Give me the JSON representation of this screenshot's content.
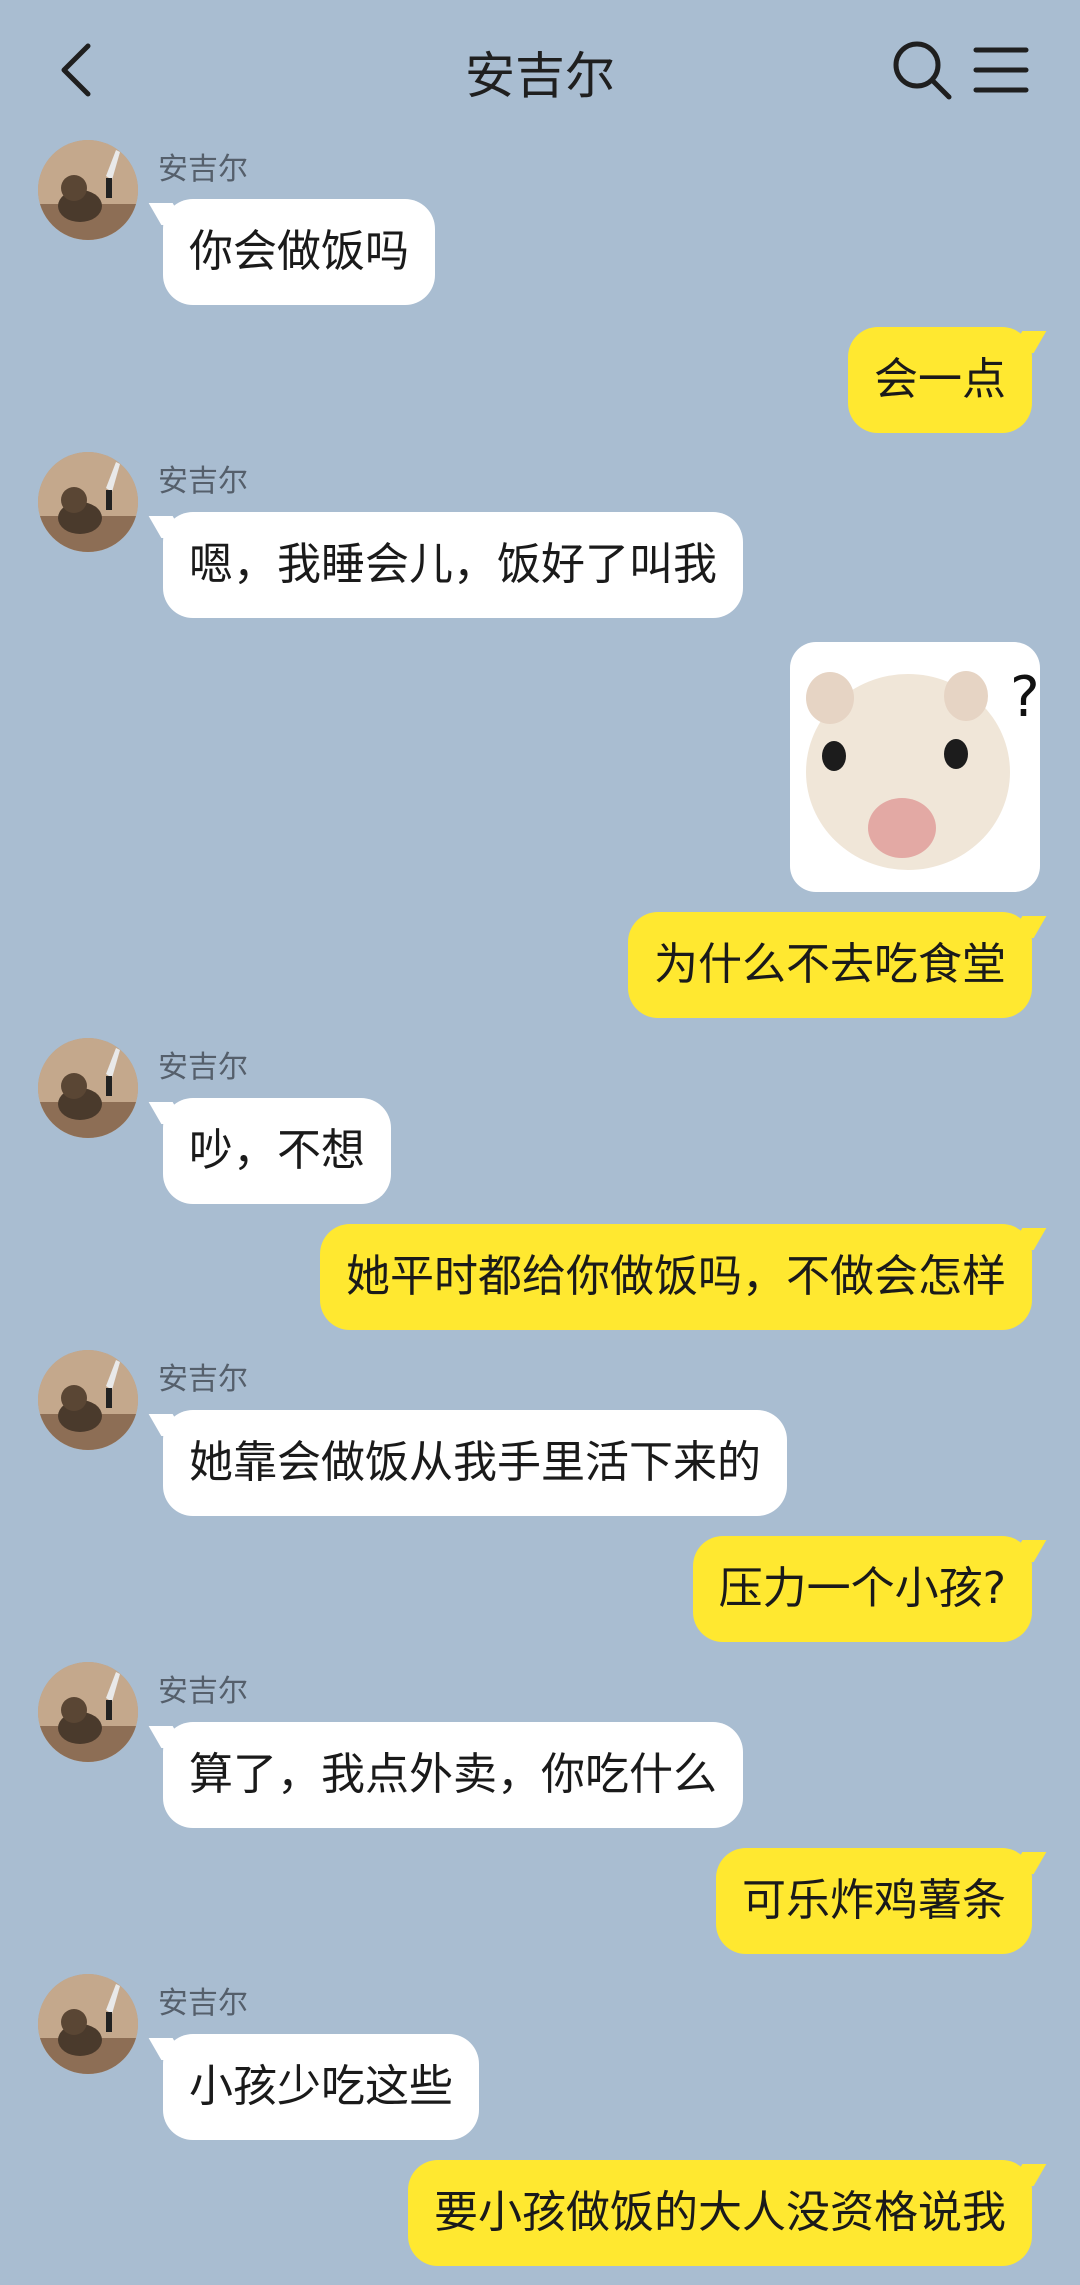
{
  "header": {
    "title": "安吉尔"
  },
  "messages": [
    {
      "sender": "安吉尔",
      "text": "你会做饭吗"
    },
    {
      "text": "会一点"
    },
    {
      "sender": "安吉尔",
      "text": "嗯，我睡会儿，饭好了叫我"
    },
    {
      "sticker": "hamster-question-sticker",
      "sticker_text": "?"
    },
    {
      "text": "为什么不去吃食堂"
    },
    {
      "sender": "安吉尔",
      "text": "吵，不想"
    },
    {
      "text": "她平时都给你做饭吗，不做会怎样"
    },
    {
      "sender": "安吉尔",
      "text": "她靠会做饭从我手里活下来的"
    },
    {
      "text": "压力一个小孩?"
    },
    {
      "sender": "安吉尔",
      "text": "算了，我点外卖，你吃什么"
    },
    {
      "text": "可乐炸鸡薯条"
    },
    {
      "sender": "安吉尔",
      "text": "小孩少吃这些"
    },
    {
      "text": "要小孩做饭的大人没资格说我"
    }
  ],
  "colors": {
    "background": "#a9bdd1",
    "outgoing_bubble": "#ffe830",
    "incoming_bubble": "#ffffff"
  },
  "icons": {
    "back": "chevron-left-icon",
    "search": "search-icon",
    "menu": "menu-icon"
  }
}
